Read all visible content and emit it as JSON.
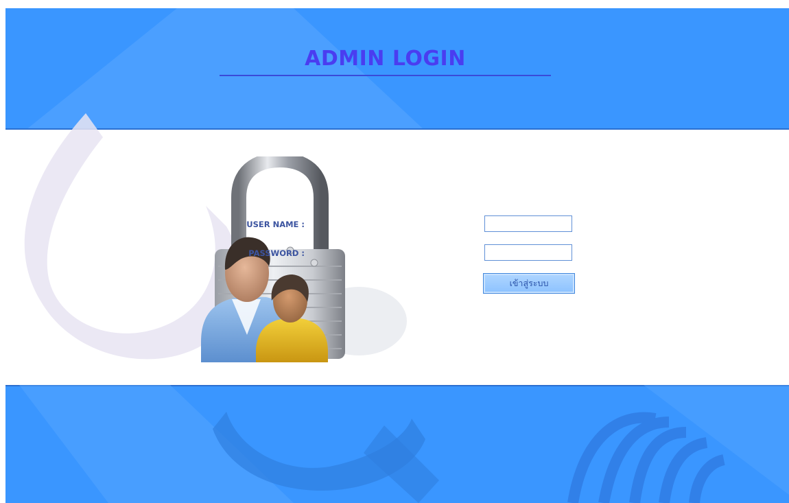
{
  "page": {
    "title": "ADMIN LOGIN"
  },
  "form": {
    "username_label": "USER NAME :",
    "username_value": "",
    "password_label": "PASSWORD :",
    "password_value": "",
    "submit_label": "เข้าสู่ระบบ"
  },
  "colors": {
    "band_blue": "#3a96ff",
    "title": "#4a3df0",
    "label": "#3c54a0",
    "button_fill": "#9dcbff"
  },
  "icons": {
    "illustration": "padlock-with-users"
  }
}
